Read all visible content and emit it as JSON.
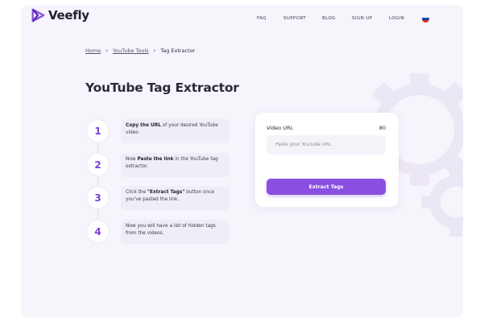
{
  "brand": {
    "name": "Veefly",
    "accent": "#8a4fe0",
    "logo_icon": "play-triangle-icon"
  },
  "nav": {
    "items": [
      {
        "label": "FAQ"
      },
      {
        "label": "SUPPORT"
      },
      {
        "label": "BLOG"
      },
      {
        "label": "SIGN UP"
      },
      {
        "label": "LOGIN"
      }
    ],
    "language_flag": "russia-flag-icon"
  },
  "breadcrumb": {
    "items": [
      {
        "label": "Home"
      },
      {
        "label": "YouTube Tools"
      }
    ],
    "current": "Tag Extractor"
  },
  "page": {
    "title": "YouTube Tag Extractor"
  },
  "steps": [
    {
      "number": "1",
      "bold": "Copy the URL",
      "pre": "",
      "post": " of your desired YouTube video"
    },
    {
      "number": "2",
      "pre": "Now ",
      "bold": "Paste the link",
      "post": " in the YouTube tag extractor."
    },
    {
      "number": "3",
      "pre": "Click the ",
      "bold": "\"Extract Tags\"",
      "post": " button once you've pasted the link."
    },
    {
      "number": "4",
      "pre": "Now you will have a list of hidden tags from the videos.",
      "bold": "",
      "post": ""
    }
  ],
  "form": {
    "url_label": "Video URL",
    "char_count": "80",
    "url_value": "",
    "url_placeholder": "Paste your YouTube URL",
    "submit_label": "Extract Tags"
  }
}
